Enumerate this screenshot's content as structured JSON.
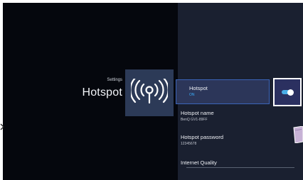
{
  "header": {
    "breadcrumb": "Settings",
    "title": "Hotspot"
  },
  "hero": {
    "icon": "wifi-hotspot-icon"
  },
  "settings": {
    "items": [
      {
        "title": "Hotspot",
        "subtitle": "ON"
      },
      {
        "title": "Hotspot name",
        "subtitle": "BenQ GV1-89FF"
      },
      {
        "title": "Hotspot password",
        "subtitle": "12345678"
      },
      {
        "title": "Internet Quality"
      }
    ],
    "toggle": {
      "state": "on"
    }
  },
  "colors": {
    "background": "#04060c",
    "right_panel": "#1a2030",
    "hero_tile": "#2c3a57",
    "selected_item": "#2c3659",
    "accent": "#3ab0ff"
  }
}
